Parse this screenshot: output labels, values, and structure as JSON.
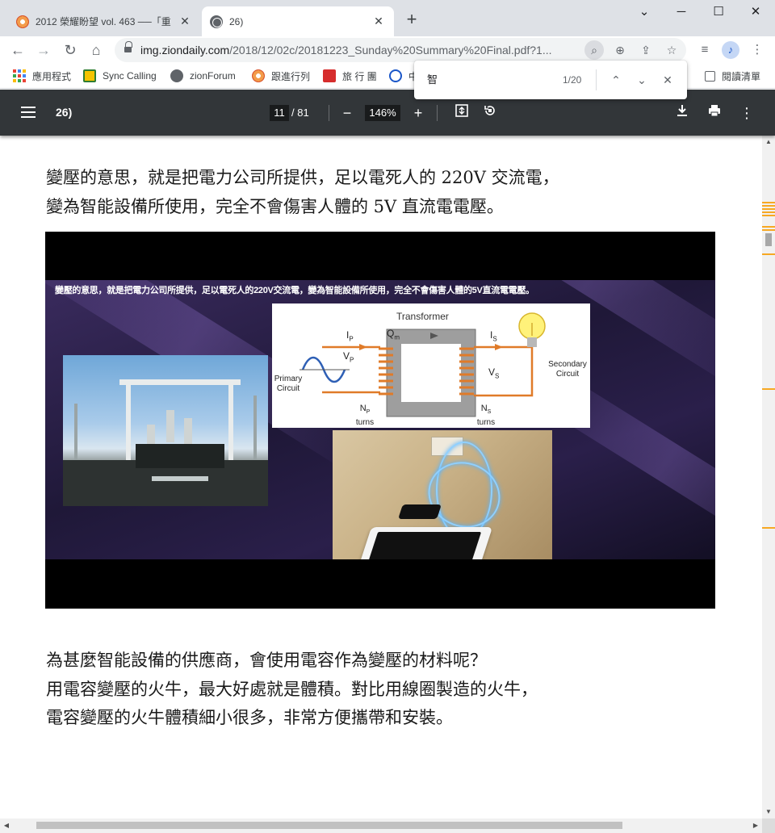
{
  "browser": {
    "tabs": [
      {
        "title": "2012 榮耀盼望 vol. 463 ──「重",
        "active": false
      },
      {
        "title": "26)",
        "active": true
      }
    ],
    "new_tab_label": "+",
    "window_controls": {
      "minimize": "─",
      "maximize": "☐",
      "close": "✕",
      "tab_menu": "⌄"
    },
    "url_host": "img.ziondaily.com",
    "url_rest": "/2018/12/02c/20181223_Sunday%20Summary%20Final.pdf?1...",
    "bookmarks": [
      {
        "label": "應用程式",
        "icon": "apps-grid-icon"
      },
      {
        "label": "Sync Calling",
        "icon": "sync-calling-icon",
        "color": "#f5c400"
      },
      {
        "label": "zionForum",
        "icon": "globe-icon",
        "color": "#5f6368"
      },
      {
        "label": "跟進行列",
        "icon": "follow-icon",
        "color": "#f39c4a"
      },
      {
        "label": "旅 行 團",
        "icon": "travel-icon",
        "color": "#d62d2d"
      },
      {
        "label": "中",
        "icon": "gear-bookmark-icon",
        "color": "#1a56c8"
      }
    ],
    "reading_list": "閱讀清單",
    "profile_initial": "♪"
  },
  "find_bar": {
    "query": "智",
    "count": "1/20",
    "prev": "⌃",
    "next": "⌄",
    "close": "✕"
  },
  "pdf_viewer": {
    "title": "26)",
    "current_page": "11",
    "total_pages": "/ 81",
    "zoom": "146%",
    "zoom_out": "−",
    "zoom_in": "+"
  },
  "document": {
    "para1_line1": "變壓的意思，就是把電力公司所提供，足以電死人的 220V 交流電，",
    "para1_line2": "變為智能設備所使用，完全不會傷害人體的 5V 直流電電壓。",
    "slide_caption": "變壓的意思，就是把電力公司所提供，足以電死人的220V交流電，變為智能設備所使用，完全不會傷害人體的5V直流電電壓。",
    "diagram": {
      "title": "Transformer",
      "ip": "I",
      "ip_sub": "P",
      "qm": "Q",
      "qm_sub": "m",
      "is": "I",
      "is_sub": "S",
      "vp": "V",
      "vp_sub": "P",
      "vs": "V",
      "vs_sub": "S",
      "primary_line1": "Primary",
      "primary_line2": "Circuit",
      "secondary_line1": "Secondary",
      "secondary_line2": "Circuit",
      "np": "N",
      "np_sub": "P",
      "ns": "N",
      "ns_sub": "S",
      "turns": "turns"
    },
    "para2_line1": "為甚麼智能設備的供應商，會使用電容作為變壓的材料呢？",
    "para2_line2": "用電容變壓的火牛，最大好處就是體積。對比用線圈製造的火牛，",
    "para2_line3": "電容變壓的火牛體積細小很多，非常方便攜帶和安裝。"
  },
  "colors": {
    "find_highlight": "#f7a823",
    "pdf_toolbar": "#323639",
    "coil": "#e07b29"
  }
}
